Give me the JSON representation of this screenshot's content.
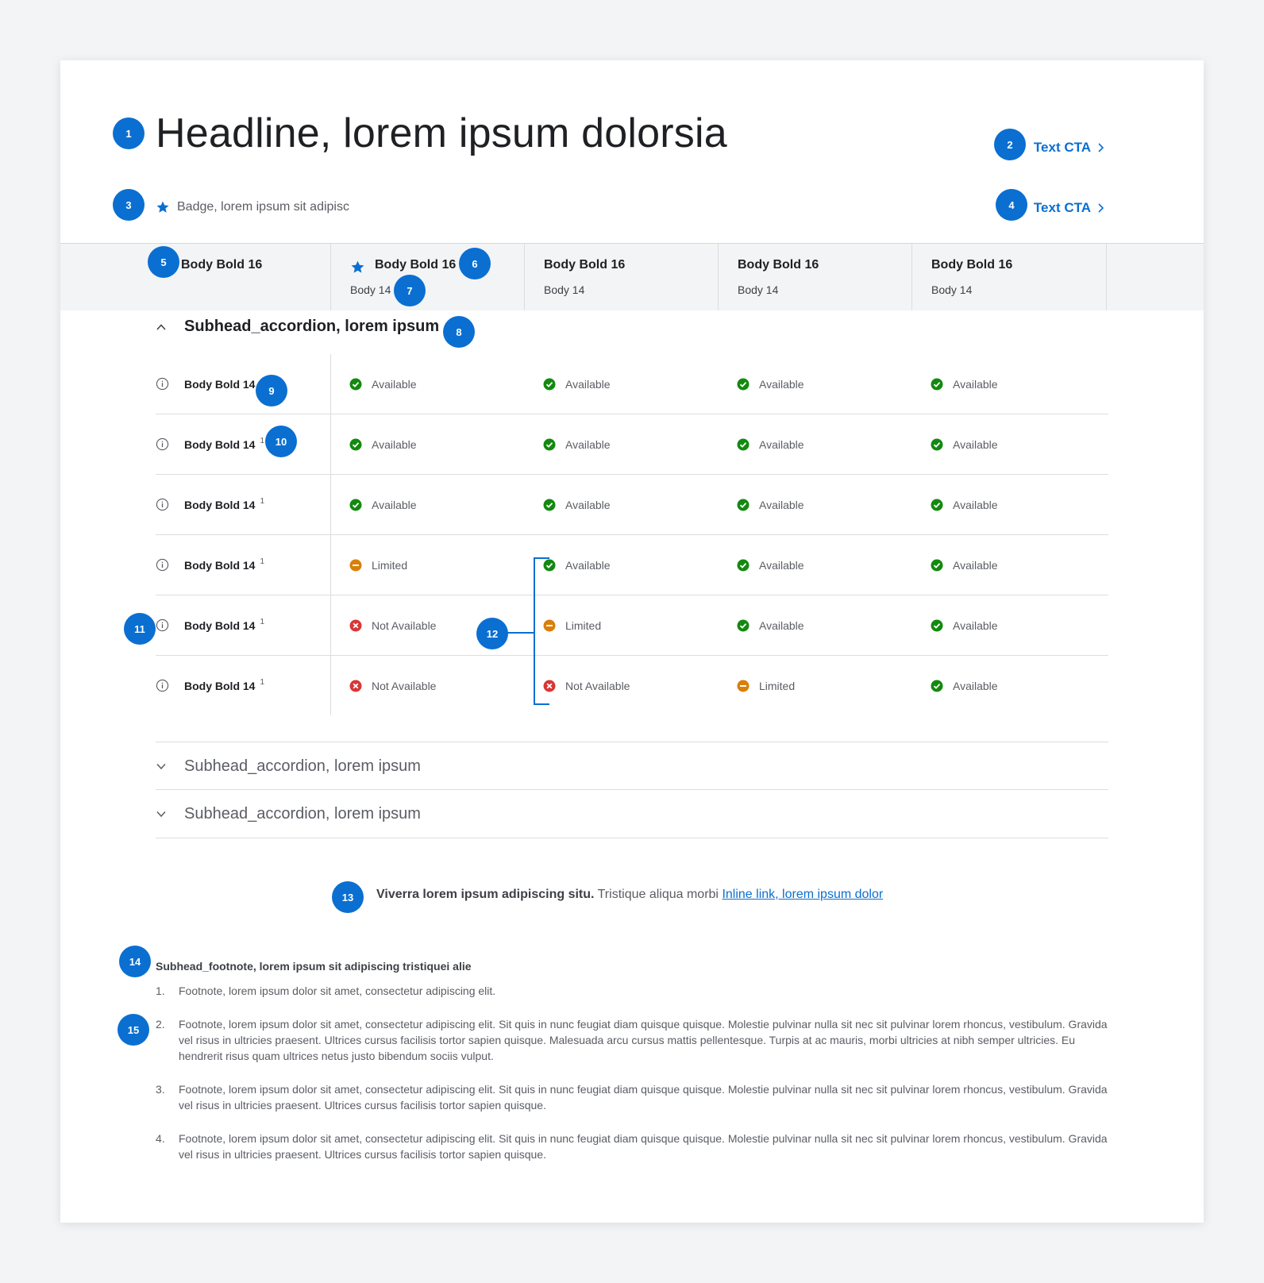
{
  "headline": "Headline, lorem ipsum dolorsia",
  "cta_primary": "Text CTA",
  "cta_secondary": "Text CTA",
  "badge": "Badge, lorem ipsum sit adipisc",
  "columns": [
    {
      "title": "Body Bold 16",
      "sub": ""
    },
    {
      "title": "Body Bold 16",
      "sub": "Body 14"
    },
    {
      "title": "Body Bold 16",
      "sub": "Body 14"
    },
    {
      "title": "Body Bold 16",
      "sub": "Body 14"
    },
    {
      "title": "Body Bold 16",
      "sub": "Body 14"
    }
  ],
  "accordion_open_title": "Subhead_accordion, lorem ipsum",
  "rows": [
    {
      "label": "Body Bold 14",
      "sup": "",
      "cells": [
        "Available",
        "Available",
        "Available",
        "Available"
      ],
      "status": [
        "ok",
        "ok",
        "ok",
        "ok"
      ]
    },
    {
      "label": "Body Bold 14",
      "sup": "1",
      "cells": [
        "Available",
        "Available",
        "Available",
        "Available"
      ],
      "status": [
        "ok",
        "ok",
        "ok",
        "ok"
      ]
    },
    {
      "label": "Body Bold 14",
      "sup": "1",
      "cells": [
        "Available",
        "Available",
        "Available",
        "Available"
      ],
      "status": [
        "ok",
        "ok",
        "ok",
        "ok"
      ]
    },
    {
      "label": "Body Bold 14",
      "sup": "1",
      "cells": [
        "Limited",
        "Available",
        "Available",
        "Available"
      ],
      "status": [
        "limited",
        "ok",
        "ok",
        "ok"
      ]
    },
    {
      "label": "Body Bold 14",
      "sup": "1",
      "cells": [
        "Not Available",
        "Limited",
        "Available",
        "Available"
      ],
      "status": [
        "no",
        "limited",
        "ok",
        "ok"
      ]
    },
    {
      "label": "Body Bold 14",
      "sup": "1",
      "cells": [
        "Not Available",
        "Not Available",
        "Limited",
        "Available"
      ],
      "status": [
        "no",
        "no",
        "limited",
        "ok"
      ]
    }
  ],
  "accordion_closed": [
    "Subhead_accordion, lorem ipsum",
    "Subhead_accordion, lorem ipsum"
  ],
  "note": {
    "bold": "Viverra lorem ipsum adipiscing situ.",
    "text": " Tristique aliqua morbi ",
    "link": "Inline link, lorem ipsum dolor"
  },
  "footnote_head": "Subhead_footnote, lorem ipsum sit adipiscing tristiquei alie",
  "footnotes": [
    "Footnote, lorem ipsum dolor sit amet, consectetur adipiscing elit.",
    "Footnote, lorem ipsum dolor sit amet, consectetur adipiscing elit. Sit quis in nunc feugiat diam quisque quisque. Molestie pulvinar nulla sit nec sit pulvinar lorem rhoncus, vestibulum. Gravida vel risus in ultricies praesent. Ultrices cursus facilisis tortor sapien quisque. Malesuada arcu cursus mattis pellentesque. Turpis at ac mauris, morbi ultricies at nibh semper ultricies. Eu hendrerit risus quam ultrices netus justo bibendum sociis vulput.",
    "Footnote, lorem ipsum dolor sit amet, consectetur adipiscing elit. Sit quis in nunc feugiat diam quisque quisque. Molestie pulvinar nulla sit nec sit pulvinar lorem rhoncus, vestibulum. Gravida vel risus in ultricies praesent. Ultrices cursus facilisis tortor sapien quisque.",
    "Footnote, lorem ipsum dolor sit amet, consectetur adipiscing elit. Sit quis in nunc feugiat diam quisque quisque. Molestie pulvinar nulla sit nec sit pulvinar lorem rhoncus, vestibulum. Gravida vel risus in ultricies praesent. Ultrices cursus facilisis tortor sapien quisque."
  ],
  "footnote_nums": [
    "1.",
    "2.",
    "3.",
    "4."
  ],
  "markers": [
    "1",
    "2",
    "3",
    "4",
    "5",
    "6",
    "7",
    "8",
    "9",
    "10",
    "11",
    "12",
    "13",
    "14",
    "15"
  ],
  "colors": {
    "accent": "#0a6fd1",
    "ok": "#13890f",
    "limited": "#d97f0a",
    "no": "#d93636"
  }
}
